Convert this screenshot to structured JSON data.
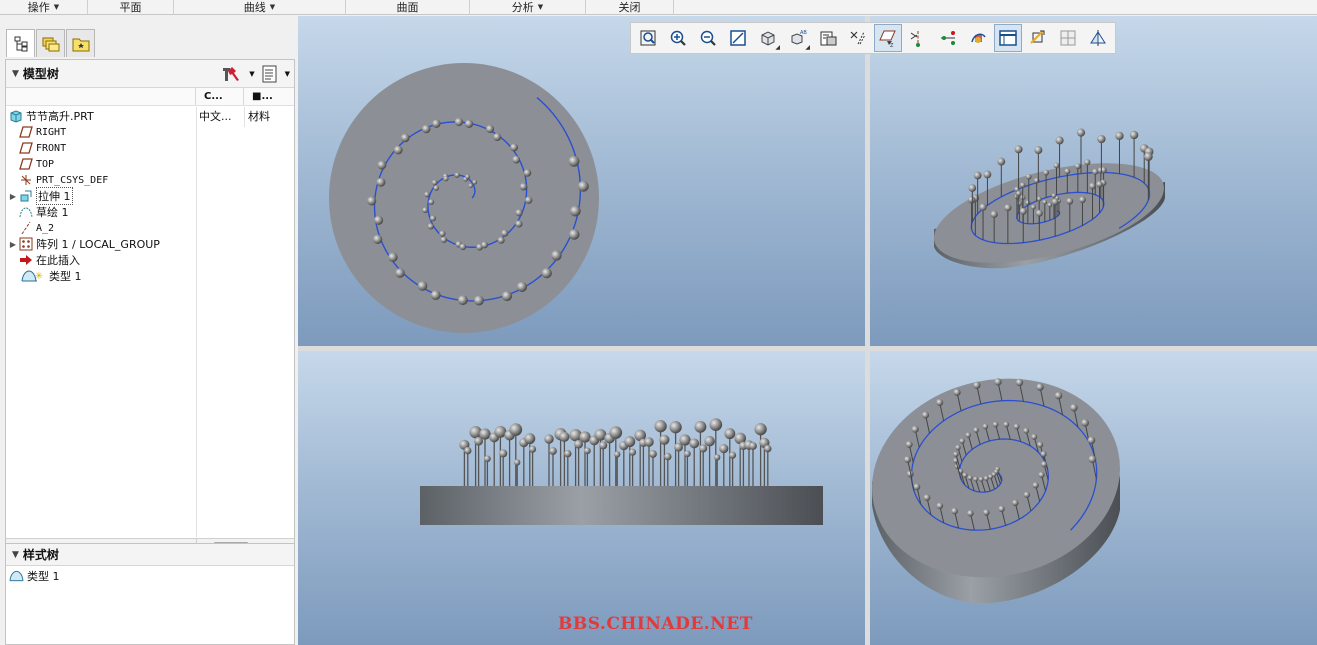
{
  "ribbon": {
    "groups": [
      {
        "label": "操作",
        "dropdown": true
      },
      {
        "label": "平面",
        "dropdown": false
      },
      {
        "label": "曲线",
        "dropdown": true
      },
      {
        "label": "曲面",
        "dropdown": false
      },
      {
        "label": "分析",
        "dropdown": true
      },
      {
        "label": "关闭",
        "dropdown": false
      }
    ]
  },
  "model_tree": {
    "title": "模型树",
    "columns": [
      "C...",
      "■..."
    ],
    "root": {
      "label": "节节高升.PRT",
      "col1": "中文...",
      "col2": "材料"
    },
    "items": [
      {
        "label": "RIGHT",
        "icon": "datum-plane-icon",
        "expandable": false
      },
      {
        "label": "FRONT",
        "icon": "datum-plane-icon",
        "expandable": false
      },
      {
        "label": "TOP",
        "icon": "datum-plane-icon",
        "expandable": false
      },
      {
        "label": "PRT_CSYS_DEF",
        "icon": "coordinate-system-icon",
        "expandable": false
      },
      {
        "label": "拉伸 1",
        "icon": "extrude-icon",
        "expandable": true
      },
      {
        "label": "草绘 1",
        "icon": "sketch-icon",
        "expandable": false
      },
      {
        "label": "A_2",
        "icon": "datum-axis-icon",
        "expandable": false
      },
      {
        "label": "阵列 1 / LOCAL_GROUP",
        "icon": "pattern-icon",
        "expandable": true
      },
      {
        "label": "在此插入",
        "icon": "insert-here-icon",
        "expandable": false
      },
      {
        "label": "类型 1",
        "icon": "style-icon",
        "expandable": false
      }
    ]
  },
  "style_tree": {
    "title": "样式树",
    "items": [
      {
        "label": "类型 1",
        "icon": "style-icon"
      }
    ]
  },
  "view_toolbar": {
    "buttons": [
      {
        "name": "refit-icon",
        "active": false,
        "dropdown": false
      },
      {
        "name": "zoom-in-icon",
        "active": false,
        "dropdown": false
      },
      {
        "name": "zoom-out-icon",
        "active": false,
        "dropdown": false
      },
      {
        "name": "repaint-icon",
        "active": false,
        "dropdown": false
      },
      {
        "name": "display-style-icon",
        "active": false,
        "dropdown": true
      },
      {
        "name": "saved-orientations-icon",
        "active": false,
        "dropdown": true
      },
      {
        "name": "view-manager-icon",
        "active": false,
        "dropdown": false
      },
      {
        "name": "perspective-icon",
        "active": false,
        "dropdown": false
      },
      {
        "name": "plane-display-icon",
        "active": true,
        "dropdown": false
      },
      {
        "name": "axis-display-icon",
        "active": false,
        "dropdown": false
      },
      {
        "name": "point-display-icon",
        "active": false,
        "dropdown": false
      },
      {
        "name": "csys-display-icon",
        "active": false,
        "dropdown": false
      },
      {
        "name": "spin-center-icon",
        "active": true,
        "dropdown": false
      },
      {
        "name": "annotation-display-icon",
        "active": false,
        "dropdown": false
      },
      {
        "name": "multi-view-icon",
        "active": false,
        "dropdown": false
      },
      {
        "name": "tangent-edges-icon",
        "active": false,
        "dropdown": false
      }
    ]
  },
  "watermark": "BBS.CHINADE.NET",
  "colors": {
    "curve": "#2b4fd1",
    "model": "#8c9096",
    "viewport_top": "#c6d8ea",
    "viewport_bottom": "#7d9abd",
    "watermark": "#e23a3a"
  }
}
